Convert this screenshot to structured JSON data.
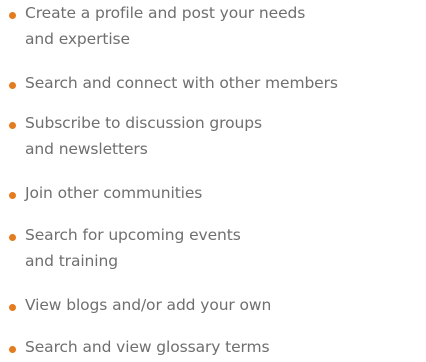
{
  "feature_list": {
    "bullet_color": "#e37b1f",
    "text_color": "#6f6f6f",
    "items": [
      {
        "label": "Create a profile and post your needs\nand expertise"
      },
      {
        "label": "Search and connect with other members"
      },
      {
        "label": "Subscribe to discussion groups\nand newsletters"
      },
      {
        "label": "Join other communities"
      },
      {
        "label": "Search for upcoming events\nand training"
      },
      {
        "label": "View blogs and/or add your own"
      },
      {
        "label": "Search and view glossary terms"
      }
    ]
  }
}
